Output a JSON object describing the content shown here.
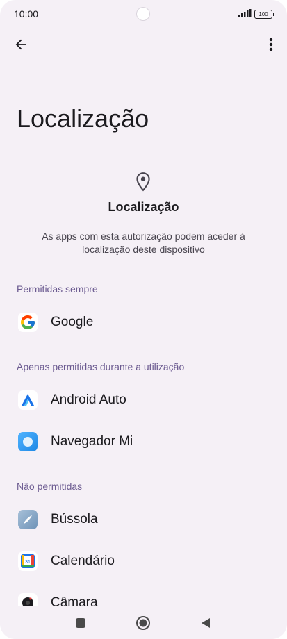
{
  "status_bar": {
    "time": "10:00",
    "battery": "100"
  },
  "page": {
    "title": "Localização"
  },
  "header": {
    "heading": "Localização",
    "description": "As apps com esta autorização podem aceder à localização deste dispositivo"
  },
  "sections": {
    "always": {
      "title": "Permitidas sempre",
      "apps": [
        {
          "label": "Google",
          "icon": "google-icon"
        }
      ]
    },
    "while_using": {
      "title": "Apenas permitidas durante a utilização",
      "apps": [
        {
          "label": "Android Auto",
          "icon": "android-auto-icon"
        },
        {
          "label": "Navegador Mi",
          "icon": "mi-browser-icon"
        }
      ]
    },
    "denied": {
      "title": "Não permitidas",
      "apps": [
        {
          "label": "Bússola",
          "icon": "compass-icon"
        },
        {
          "label": "Calendário",
          "icon": "calendar-icon"
        },
        {
          "label": "Câmara",
          "icon": "camera-icon"
        }
      ]
    }
  },
  "calendar_icon_day": "31",
  "colors": {
    "background": "#f5f0f6",
    "section_title": "#6b5a90",
    "text": "#1c1b1f"
  }
}
